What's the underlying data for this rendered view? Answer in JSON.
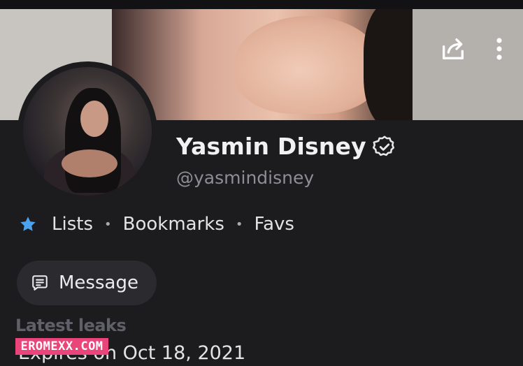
{
  "profile": {
    "name": "Yasmin Disney",
    "handle": "@yasmindisney",
    "verified_icon": "verified-badge-icon"
  },
  "nav_links": {
    "star_icon": "star-icon",
    "lists": "Lists",
    "bookmarks": "Bookmarks",
    "favs": "Favs",
    "separator": "•"
  },
  "actions": {
    "message_label": "Message",
    "message_icon": "message-icon",
    "share_icon": "share-icon",
    "more_icon": "more-vertical-icon"
  },
  "footer": {
    "latest_label": "Latest leaks",
    "expires_text": "Expires on Oct 18, 2021",
    "watermark": "EROMEXX.COM"
  },
  "colors": {
    "background": "#1c1c1e",
    "accent_star": "#4aa3ef",
    "watermark_bg": "#e9457a"
  }
}
